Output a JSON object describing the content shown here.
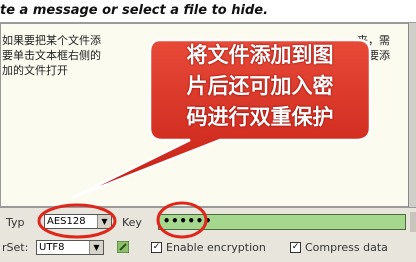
{
  "header": {
    "title": "te a message or select a file to hide."
  },
  "message_area": {
    "lines_left": [
      "如果要把某个文件添",
      "要单击文本框右侧的",
      "加的文件打开"
    ],
    "lines_right": [
      "来，需",
      "需要添"
    ]
  },
  "callout": {
    "lines": [
      "将文件添加到图",
      "片后还可加入密",
      "码进行双重保护"
    ],
    "color": "#d42b1f"
  },
  "controls": {
    "type_label": "Typ",
    "type_value": "AES128",
    "key_label": "Key",
    "key_value": "••••••",
    "charset_label": "rSet:",
    "charset_value": "UTF8",
    "enable_encryption_label": "Enable encryption",
    "enable_encryption_checked": true,
    "compress_data_label": "Compress data",
    "compress_data_checked": true
  },
  "colors": {
    "key_field": "#a6d78e",
    "highlight_ring": "#e0261b",
    "panel": "#e8e6dc",
    "message_bg": "#fbfbf0"
  }
}
